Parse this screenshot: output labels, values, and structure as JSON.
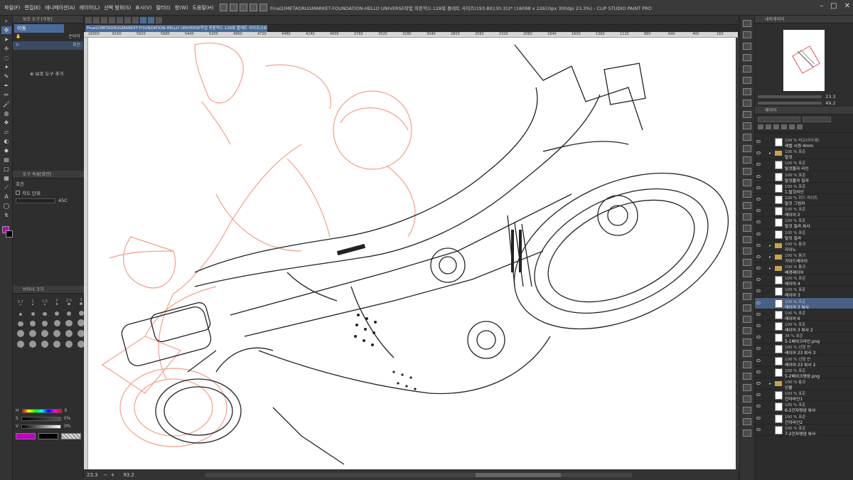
{
  "window": {
    "title": "Final2(METADRUGMARKET-FOUNDATION-HELLO UNIVERSE작업 최종적으.128복 플레트 사이즈(193.8X130.3)2* (16098 x 22610px 300dpi 23.3%) - CLIP STUDIO PAINT PRO",
    "controls": [
      "–",
      "□",
      "✕"
    ]
  },
  "menu": [
    "파일(F)",
    "편집(E)",
    "애니메이션(A)",
    "레이어(L)",
    "선택 범위(S)",
    "표시(V)",
    "필터(I)",
    "창(W)",
    "도움말(H)"
  ],
  "document_tab": "Final2(METADRUGMARKET-FOUNDATION-HELLO UNIVERSE작업 최종적으 128복 플레트 사이즈(193.8X130.3)2* ×",
  "ruler_marks": [
    "16000",
    "6160",
    "5920",
    "5680",
    "5440",
    "5200",
    "4960",
    "4720",
    "4480",
    "4240",
    "4000",
    "3760",
    "3520",
    "3280",
    "3040",
    "2800",
    "2560",
    "2320",
    "2080",
    "1840",
    "1600",
    "1360",
    "1120",
    "880",
    "640",
    "400",
    "160"
  ],
  "subtool": {
    "header": "보조 도구 [이동]",
    "tab": "이동",
    "items": [
      {
        "label": "",
        "right": "손바닥"
      },
      {
        "label": "",
        "right": "회전"
      }
    ],
    "add_button": "보조 도구 추가"
  },
  "tool_property": {
    "header": "도구 속성[회전]",
    "title": "회전",
    "option": "각도 단위",
    "angle_value": "45",
    "angle_unit": "C"
  },
  "brush_size": {
    "header": "브러시 크기",
    "labels": [
      "0.7",
      "1",
      "1.5",
      "2",
      "2.5",
      "3"
    ]
  },
  "color_sliders": [
    {
      "label": "H",
      "value": "0"
    },
    {
      "label": "S",
      "value": "0%"
    },
    {
      "label": "V",
      "value": "0%"
    }
  ],
  "colors": {
    "main": "#c000c0",
    "sub": "#000000",
    "accent": "#4a6b9a"
  },
  "status": {
    "zoom": "23.3",
    "angle": "93.2"
  },
  "navigator": {
    "header": "내비게이터",
    "zoom": "23.3",
    "rotation": "49.2"
  },
  "layers": {
    "header": "레이어",
    "items": [
      {
        "mode": "100 % 비교(어두움)",
        "name": "레벨 시원 4mm",
        "type": "paper",
        "indent": 0
      },
      {
        "mode": "100 % 표준",
        "name": "탈것",
        "type": "folder",
        "indent": 0
      },
      {
        "mode": "100 % 표준",
        "name": "탈것물자 라인",
        "type": "layer",
        "indent": 1
      },
      {
        "mode": "100 % 표준",
        "name": "탈것물자 칠라",
        "type": "layer",
        "indent": 1
      },
      {
        "mode": "100 % 표준",
        "name": "1.탈것라인",
        "type": "layer",
        "indent": 1
      },
      {
        "mode": "100 % 하드 라이트",
        "name": "탈것 그림자",
        "type": "layer",
        "indent": 1
      },
      {
        "mode": "100 % 표준",
        "name": "레이어 2",
        "type": "layer",
        "indent": 1
      },
      {
        "mode": "100 % 표준",
        "name": "탈것 칠라 복사",
        "type": "layer",
        "indent": 1
      },
      {
        "mode": "100 % 표준",
        "name": "탈것 칠라",
        "type": "layer",
        "indent": 1
      },
      {
        "mode": "100 % 통과",
        "name": "자이노",
        "type": "folder",
        "indent": 0
      },
      {
        "mode": "100 % 통과",
        "name": "가이드레이어",
        "type": "folder",
        "indent": 0
      },
      {
        "mode": "100 % 통과",
        "name": "배경레이어",
        "type": "folder",
        "indent": 0
      },
      {
        "mode": "100 % 표준",
        "name": "레이어 4",
        "type": "layer",
        "indent": 1
      },
      {
        "mode": "100 % 표준",
        "name": "레이어 3",
        "type": "layer",
        "indent": 1
      },
      {
        "mode": "100 % 표준",
        "name": "레이어 3 복사",
        "type": "layer",
        "indent": 1,
        "selected": true
      },
      {
        "mode": "100 % 표준",
        "name": "레이어 6",
        "type": "layer",
        "indent": 1
      },
      {
        "mode": "100 % 표준",
        "name": "레이어 3 복사 2",
        "type": "layer",
        "indent": 1
      },
      {
        "mode": "36 % 표준",
        "name": "5-1배이크라인.png",
        "type": "layer",
        "indent": 1
      },
      {
        "mode": "100 % 선형 번",
        "name": "레이어 23 복사 3",
        "type": "layer",
        "indent": 1
      },
      {
        "mode": "100 % 선형 번",
        "name": "레이어 23 복사 2",
        "type": "layer",
        "indent": 1
      },
      {
        "mode": "100 % 표준",
        "name": "5-2배이크명암.png",
        "type": "layer",
        "indent": 1
      },
      {
        "mode": "100 % 통과",
        "name": "인물",
        "type": "folder",
        "indent": 0
      },
      {
        "mode": "100 % 표준",
        "name": "건자라인1",
        "type": "layer",
        "indent": 1
      },
      {
        "mode": "100 % 표준",
        "name": "6-2건자명암 복사",
        "type": "layer",
        "indent": 1
      },
      {
        "mode": "100 % 표준",
        "name": "건자라인2",
        "type": "layer",
        "indent": 1
      },
      {
        "mode": "100 % 표준",
        "name": "7-2건자명암 복사",
        "type": "layer",
        "indent": 1
      }
    ]
  }
}
